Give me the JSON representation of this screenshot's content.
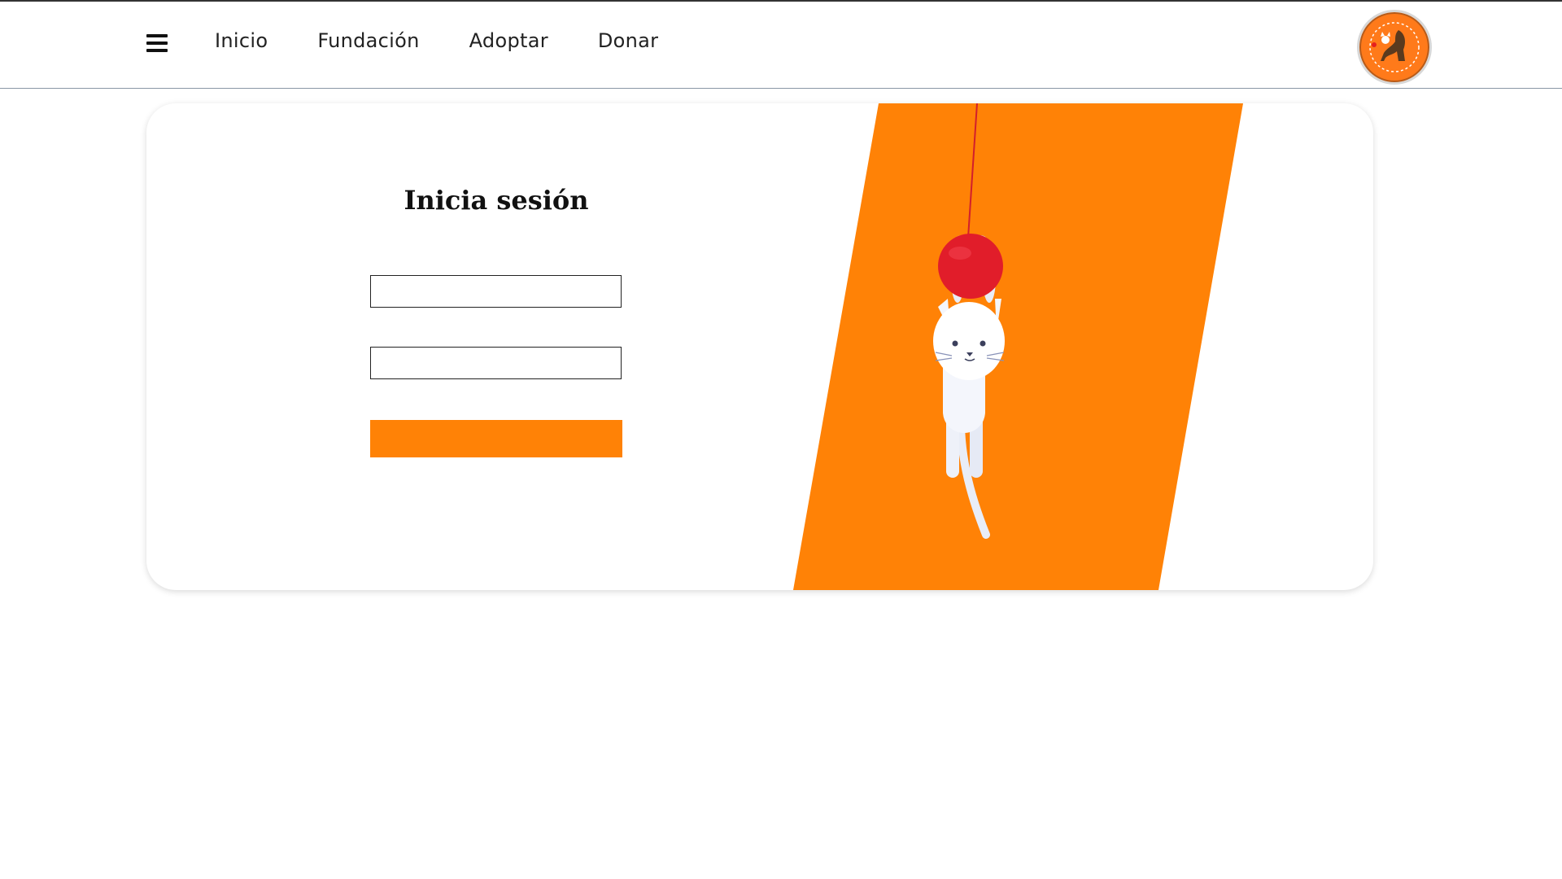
{
  "nav": {
    "menu_icon": "hamburger-menu-icon",
    "links": [
      "Inicio",
      "Fundación",
      "Adoptar",
      "Donar"
    ],
    "logo_icon": "foundation-logo"
  },
  "login": {
    "title": "Inicia sesión",
    "username_value": "",
    "password_value": "",
    "submit_label": ""
  },
  "illustration": {
    "icon": "hanging-cat-with-yarn-ball",
    "band_color": "#ff8206"
  },
  "colors": {
    "accent": "#ff8206"
  }
}
